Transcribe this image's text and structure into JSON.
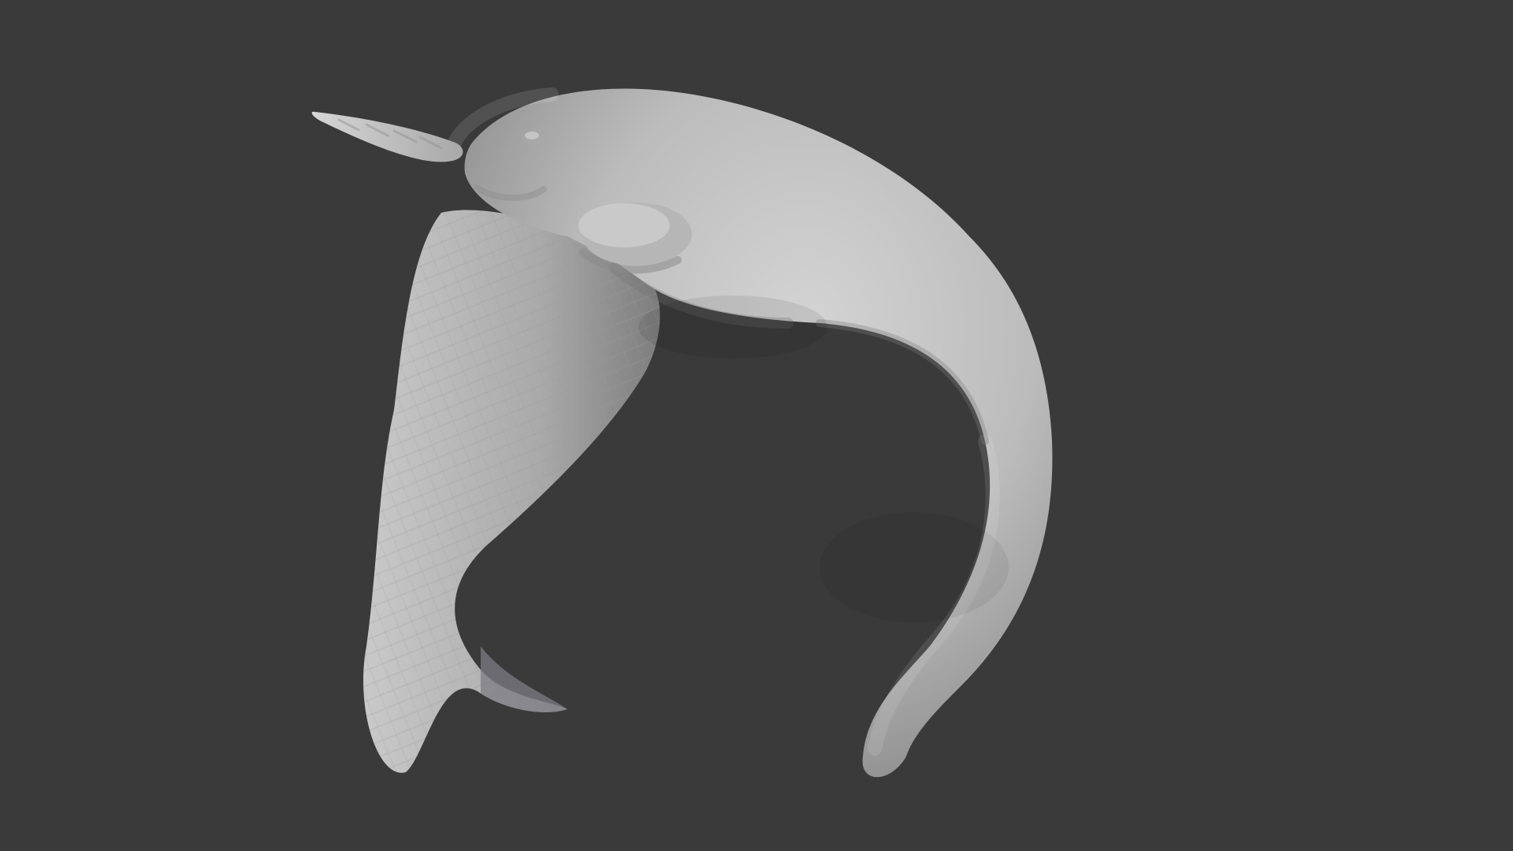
{
  "viewport": {
    "background_color": "#3a3a3a",
    "model": {
      "icon": "narwhal-sculpt",
      "shape": "curved whale-like body with horn",
      "body_color": "#bdbdbd",
      "highlight_color": "#d0d0d0",
      "shadow_color": "#6b6b6b"
    }
  }
}
